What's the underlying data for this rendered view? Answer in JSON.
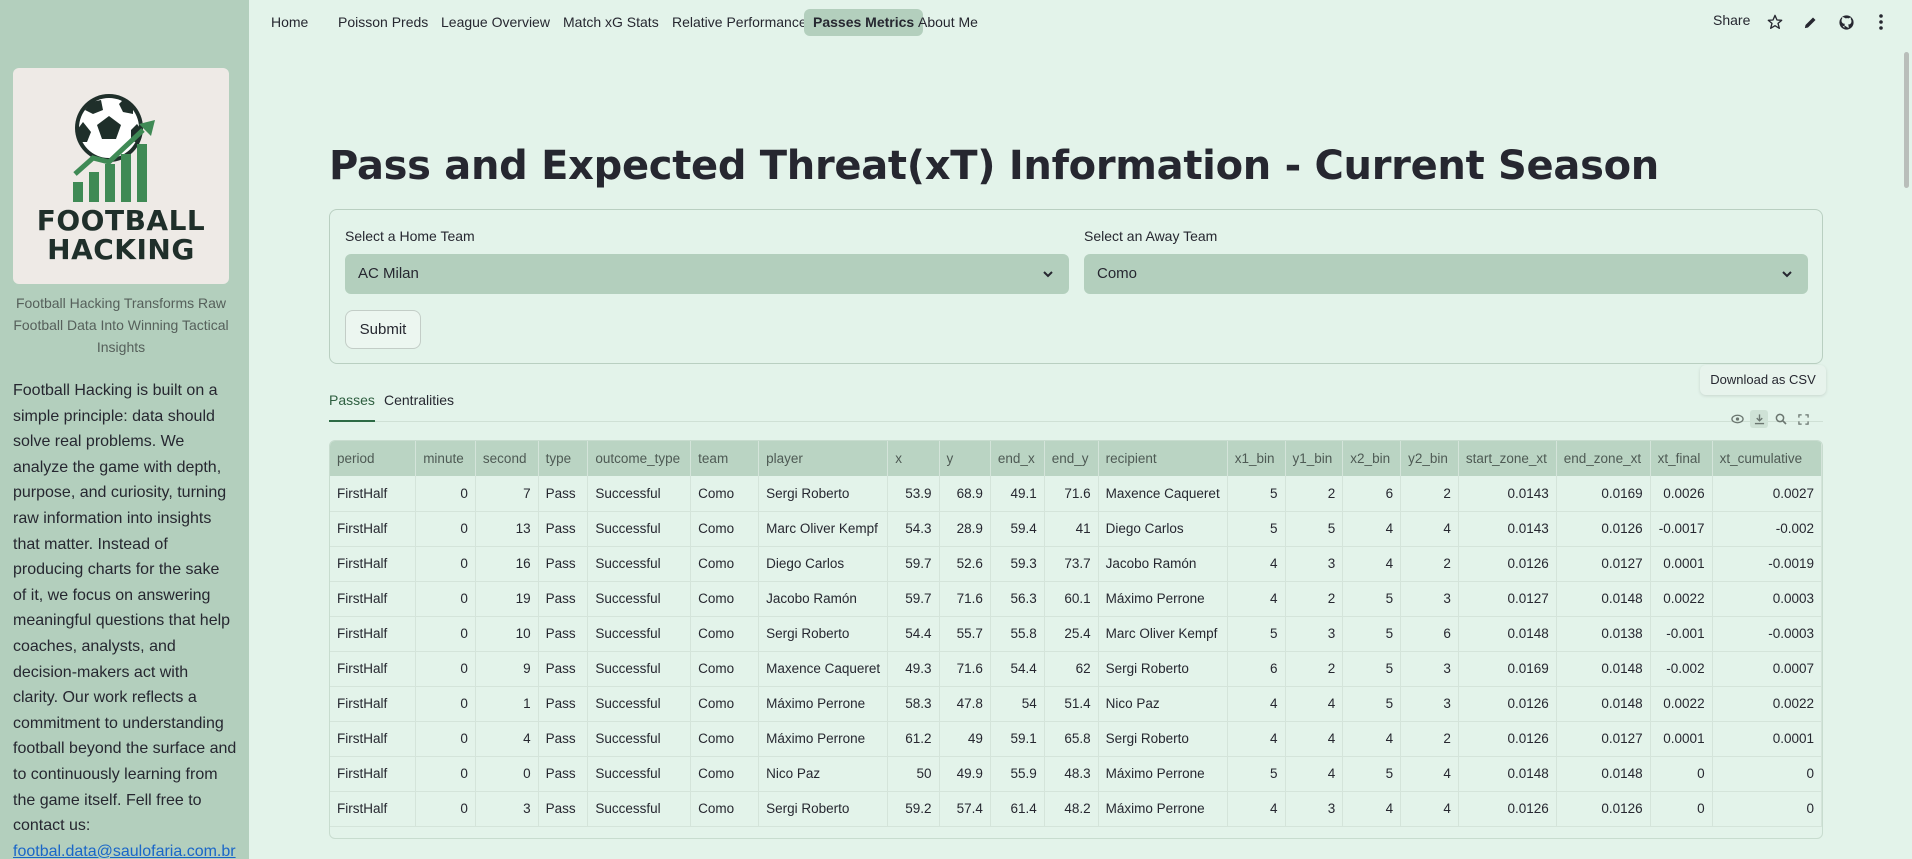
{
  "nav": {
    "items": [
      "Home",
      "Poisson Preds",
      "League Overview",
      "Match xG Stats",
      "Relative Performance",
      "Passes Metrics",
      "About Me"
    ],
    "active": "Passes Metrics",
    "share_label": "Share",
    "icons": [
      "star-icon",
      "edit-icon",
      "github-icon",
      "more-vertical-icon"
    ]
  },
  "sidebar": {
    "logo_text_line1": "FOOTBALL",
    "logo_text_line2": "HACKING",
    "tagline": "Football Hacking Transforms Raw Football Data Into Winning Tactical Insights",
    "about": "Football Hacking is built on a simple principle: data should solve real problems. We analyze the game with depth, purpose, and curiosity, turning raw information into insights that matter. Instead of producing charts for the sake of it, we focus on answering meaningful questions that help coaches, analysts, and decision-makers act with clarity. Our work reflects a commitment to understanding football beyond the surface and to continuously learning from the game itself. Fell free to contact us:",
    "contact_email": "footbal.data@saulofaria.com.br"
  },
  "main": {
    "title": "Pass and Expected Threat(xT) Information - Current Season",
    "home_label": "Select a Home Team",
    "home_value": "AC Milan",
    "away_label": "Select an Away Team",
    "away_value": "Como",
    "submit_label": "Submit",
    "tabs": [
      "Passes",
      "Centralities"
    ],
    "active_tab": "Passes",
    "tooltip": "Download as CSV"
  },
  "table": {
    "columns": [
      "period",
      "minute",
      "second",
      "type",
      "outcome_type",
      "team",
      "player",
      "x",
      "y",
      "end_x",
      "end_y",
      "recipient",
      "x1_bin",
      "y1_bin",
      "x2_bin",
      "y2_bin",
      "start_zone_xt",
      "end_zone_xt",
      "xt_final",
      "xt_cumulative"
    ],
    "rows": [
      [
        "FirstHalf",
        "0",
        "7",
        "Pass",
        "Successful",
        "Como",
        "Sergi Roberto",
        "53.9",
        "68.9",
        "49.1",
        "71.6",
        "Maxence Caqueret",
        "5",
        "2",
        "6",
        "2",
        "0.0143",
        "0.0169",
        "0.0026",
        "0.0027"
      ],
      [
        "FirstHalf",
        "0",
        "13",
        "Pass",
        "Successful",
        "Como",
        "Marc Oliver Kempf",
        "54.3",
        "28.9",
        "59.4",
        "41",
        "Diego Carlos",
        "5",
        "5",
        "4",
        "4",
        "0.0143",
        "0.0126",
        "-0.0017",
        "-0.002"
      ],
      [
        "FirstHalf",
        "0",
        "16",
        "Pass",
        "Successful",
        "Como",
        "Diego Carlos",
        "59.7",
        "52.6",
        "59.3",
        "73.7",
        "Jacobo Ramón",
        "4",
        "3",
        "4",
        "2",
        "0.0126",
        "0.0127",
        "0.0001",
        "-0.0019"
      ],
      [
        "FirstHalf",
        "0",
        "19",
        "Pass",
        "Successful",
        "Como",
        "Jacobo Ramón",
        "59.7",
        "71.6",
        "56.3",
        "60.1",
        "Máximo Perrone",
        "4",
        "2",
        "5",
        "3",
        "0.0127",
        "0.0148",
        "0.0022",
        "0.0003"
      ],
      [
        "FirstHalf",
        "0",
        "10",
        "Pass",
        "Successful",
        "Como",
        "Sergi Roberto",
        "54.4",
        "55.7",
        "55.8",
        "25.4",
        "Marc Oliver Kempf",
        "5",
        "3",
        "5",
        "6",
        "0.0148",
        "0.0138",
        "-0.001",
        "-0.0003"
      ],
      [
        "FirstHalf",
        "0",
        "9",
        "Pass",
        "Successful",
        "Como",
        "Maxence Caqueret",
        "49.3",
        "71.6",
        "54.4",
        "62",
        "Sergi Roberto",
        "6",
        "2",
        "5",
        "3",
        "0.0169",
        "0.0148",
        "-0.002",
        "0.0007"
      ],
      [
        "FirstHalf",
        "0",
        "1",
        "Pass",
        "Successful",
        "Como",
        "Máximo Perrone",
        "58.3",
        "47.8",
        "54",
        "51.4",
        "Nico Paz",
        "4",
        "4",
        "5",
        "3",
        "0.0126",
        "0.0148",
        "0.0022",
        "0.0022"
      ],
      [
        "FirstHalf",
        "0",
        "4",
        "Pass",
        "Successful",
        "Como",
        "Máximo Perrone",
        "61.2",
        "49",
        "59.1",
        "65.8",
        "Sergi Roberto",
        "4",
        "4",
        "4",
        "2",
        "0.0126",
        "0.0127",
        "0.0001",
        "0.0001"
      ],
      [
        "FirstHalf",
        "0",
        "0",
        "Pass",
        "Successful",
        "Como",
        "Nico Paz",
        "50",
        "49.9",
        "55.9",
        "48.3",
        "Máximo Perrone",
        "5",
        "4",
        "5",
        "4",
        "0.0148",
        "0.0148",
        "0",
        "0"
      ],
      [
        "FirstHalf",
        "0",
        "3",
        "Pass",
        "Successful",
        "Como",
        "Sergi Roberto",
        "59.2",
        "57.4",
        "61.4",
        "48.2",
        "Máximo Perrone",
        "4",
        "3",
        "4",
        "4",
        "0.0126",
        "0.0126",
        "0",
        "0"
      ]
    ]
  }
}
